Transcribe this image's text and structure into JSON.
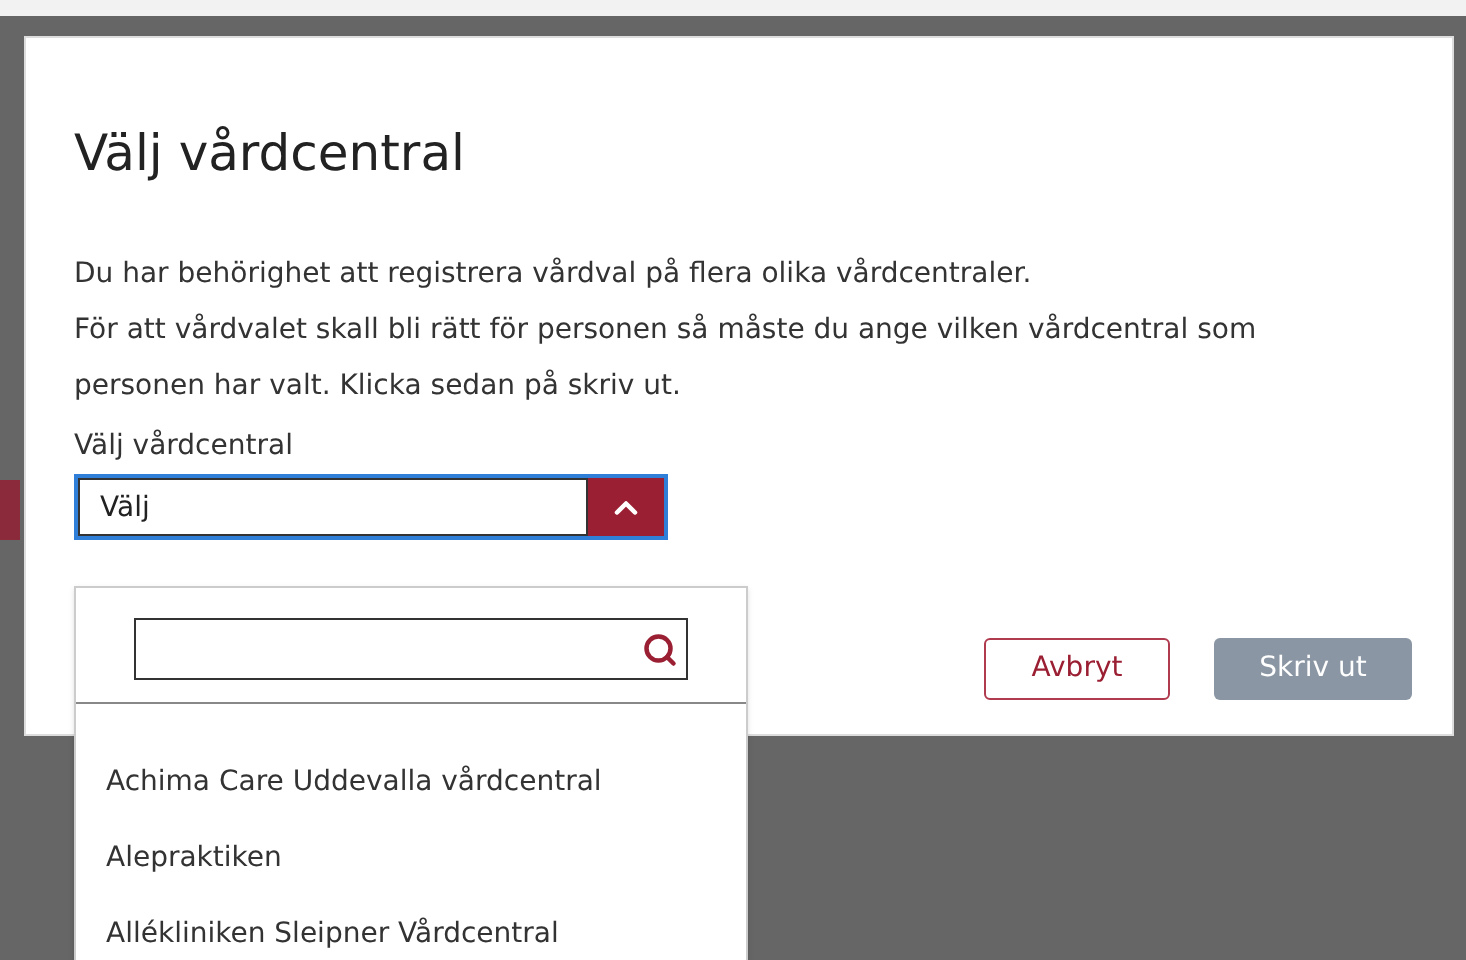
{
  "dialog": {
    "title": "Välj vårdcentral",
    "description_lines": [
      "Du har behörighet att registrera vårdval på flera olika vårdcentraler.",
      "För att vårdvalet skall bli rätt för personen så måste du ange vilken vårdcentral som personen har valt. Klicka sedan på skriv ut."
    ],
    "select": {
      "label": "Välj vårdcentral",
      "value": "Välj",
      "expanded": true
    },
    "dropdown": {
      "options": [
        {
          "label": "Achima Care Uddevalla vårdcentral",
          "selected": false
        },
        {
          "label": "Alepraktiken",
          "selected": false
        },
        {
          "label": "Allékliniken Sleipner Vårdcentral",
          "selected": false
        }
      ]
    },
    "buttons": [
      {
        "label": "Avbryt",
        "kind": "secondary"
      },
      {
        "label": "Skriv ut",
        "kind": "primary"
      }
    ]
  }
}
